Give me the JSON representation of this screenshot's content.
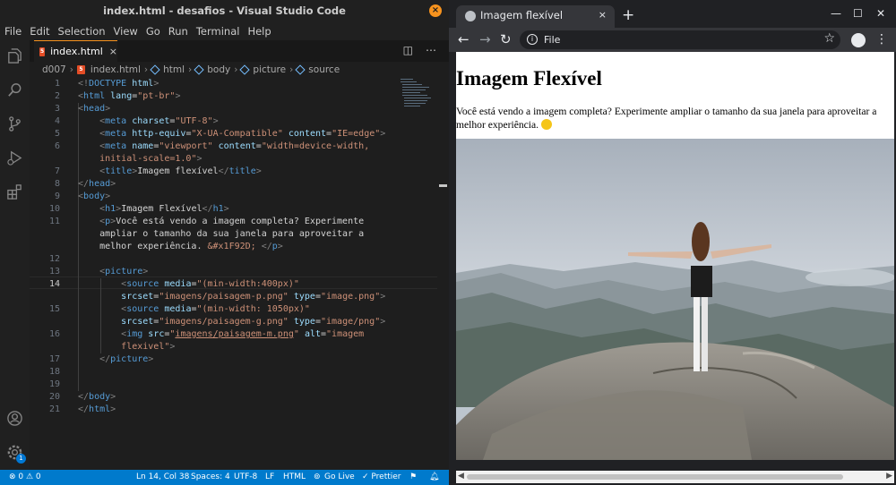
{
  "vscode": {
    "title": "index.html - desafios - Visual Studio Code",
    "menu": [
      "File",
      "Edit",
      "Selection",
      "View",
      "Go",
      "Run",
      "Terminal",
      "Help"
    ],
    "tab": {
      "label": "index.html",
      "close": "×"
    },
    "breadcrumb": [
      "d007",
      "index.html",
      "html",
      "body",
      "picture",
      "source"
    ],
    "line_numbers": [
      "1",
      "2",
      "3",
      "4",
      "5",
      "6",
      "",
      "7",
      "8",
      "9",
      "10",
      "11",
      "",
      "",
      "12",
      "13",
      "14",
      "",
      "15",
      "",
      "16",
      "",
      "17",
      "18",
      "19",
      "20",
      "21"
    ],
    "current_line": "14",
    "status": {
      "problems": "⊗ 0 ⚠ 0",
      "position": "Ln 14, Col 38",
      "spaces": "Spaces: 4",
      "encoding": "UTF-8",
      "eol": "LF",
      "language": "HTML",
      "golive": "Go Live",
      "prettier": "✓ Prettier"
    },
    "accounts_badge": "1"
  },
  "chrome": {
    "tab_title": "Imagem flexível",
    "tab_close": "×",
    "new_tab": "+",
    "url_scheme": "File",
    "page": {
      "heading": "Imagem Flexível",
      "paragraph": "Você está vendo a imagem completa? Experimente ampliar o tamanho da sua janela para aproveitar a melhor experiência."
    }
  }
}
